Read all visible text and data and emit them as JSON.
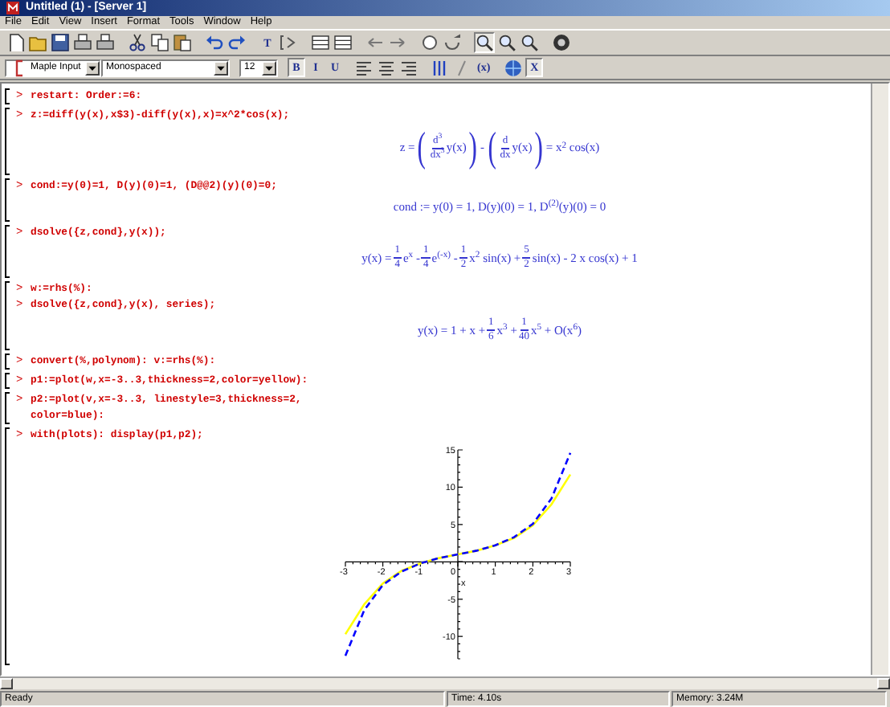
{
  "window": {
    "title": "Untitled (1) - [Server 1]"
  },
  "menu": [
    "File",
    "Edit",
    "View",
    "Insert",
    "Format",
    "Tools",
    "Window",
    "Help"
  ],
  "toolbar": [
    [
      {
        "kind": "new"
      },
      {
        "kind": "open"
      },
      {
        "kind": "save"
      },
      {
        "kind": "print"
      },
      {
        "kind": "print"
      }
    ],
    [
      {
        "kind": "cut"
      },
      {
        "kind": "copy"
      },
      {
        "kind": "paste"
      }
    ],
    [
      {
        "kind": "undo"
      },
      {
        "kind": "redo"
      }
    ],
    [
      {
        "kind": "letter",
        "label": "T"
      },
      {
        "kind": "prompt"
      }
    ],
    [
      {
        "kind": "grid"
      },
      {
        "kind": "grid"
      }
    ],
    [
      {
        "kind": "back"
      },
      {
        "kind": "forward"
      }
    ],
    [
      {
        "kind": "circle"
      },
      {
        "kind": "refresh"
      }
    ],
    [
      {
        "kind": "zoom",
        "selected": true
      },
      {
        "kind": "zoom",
        "selected": false
      },
      {
        "kind": "zoom",
        "selected": false
      }
    ],
    [
      {
        "kind": "help"
      }
    ]
  ],
  "format_bar": {
    "style": "Maple Input",
    "font": "Monospaced",
    "size": "12",
    "groups": [
      [
        {
          "kind": "letter",
          "label": "B",
          "selected": true
        },
        {
          "kind": "letter",
          "label": "I",
          "selected": false
        },
        {
          "kind": "letter",
          "label": "U",
          "selected": false
        }
      ],
      [
        {
          "kind": "align_left"
        },
        {
          "kind": "align_center"
        },
        {
          "kind": "align_right"
        }
      ],
      [
        {
          "kind": "bars"
        },
        {
          "kind": "slash"
        },
        {
          "kind": "letter",
          "label": "(x)"
        }
      ],
      [
        {
          "kind": "globe",
          "selected": false
        },
        {
          "kind": "letter",
          "label": "X",
          "selected": true
        }
      ]
    ]
  },
  "worksheet": [
    {
      "inputs": [
        {
          "prompt": ">",
          "lines": [
            "restart: Order:=6:"
          ]
        }
      ]
    },
    {
      "inputs": [
        {
          "prompt": ">",
          "lines": [
            "z:=diff(y(x),x$3)-diff(y(x),x)=x^2*cos(x);"
          ]
        }
      ],
      "output": {
        "kind": "math",
        "tokens": [
          {
            "kind": "text",
            "text": "z = "
          },
          {
            "kind": "paren",
            "text": "("
          },
          {
            "kind": "frac",
            "num": "d$^{3}$",
            "den": "dx$^{3}$"
          },
          {
            "kind": "text",
            "text": "y(x)"
          },
          {
            "kind": "paren",
            "text": ")"
          },
          {
            "kind": "text",
            "text": " - "
          },
          {
            "kind": "paren",
            "text": "("
          },
          {
            "kind": "frac",
            "num": "d",
            "den": "dx"
          },
          {
            "kind": "text",
            "text": "y(x)"
          },
          {
            "kind": "paren",
            "text": ")"
          },
          {
            "kind": "text",
            "text": " = x$^{2}$ cos(x)"
          }
        ]
      }
    },
    {
      "inputs": [
        {
          "prompt": ">",
          "lines": [
            "cond:=y(0)=1, D(y)(0)=1, (D@@2)(y)(0)=0;"
          ]
        }
      ],
      "output": {
        "kind": "math",
        "tokens": [
          {
            "kind": "text",
            "text": "cond := y(0) = 1, D(y)(0) = 1, D$^{(2)}$(y)(0) = 0"
          }
        ]
      }
    },
    {
      "inputs": [
        {
          "prompt": ">",
          "lines": [
            "dsolve({z,cond},y(x));"
          ]
        }
      ],
      "output": {
        "kind": "math",
        "tokens": [
          {
            "kind": "text",
            "text": "y(x) = "
          },
          {
            "kind": "frac",
            "num": "1",
            "den": "4"
          },
          {
            "kind": "text",
            "text": "e$^{x}$ - "
          },
          {
            "kind": "frac",
            "num": "1",
            "den": "4"
          },
          {
            "kind": "text",
            "text": "e$^{(-x)}$ - "
          },
          {
            "kind": "frac",
            "num": "1",
            "den": "2"
          },
          {
            "kind": "text",
            "text": "x$^{2}$ sin(x) + "
          },
          {
            "kind": "frac",
            "num": "5",
            "den": "2"
          },
          {
            "kind": "text",
            "text": "sin(x) - 2 x cos(x) + 1"
          }
        ]
      }
    },
    {
      "inputs": [
        {
          "prompt": ">",
          "lines": [
            "w:=rhs(%):"
          ]
        },
        {
          "prompt": ">",
          "lines": [
            "dsolve({z,cond},y(x), series);"
          ]
        }
      ],
      "output": {
        "kind": "math",
        "tokens": [
          {
            "kind": "text",
            "text": "y(x) = 1 + x + "
          },
          {
            "kind": "frac",
            "num": "1",
            "den": "6"
          },
          {
            "kind": "text",
            "text": "x$^{3}$ + "
          },
          {
            "kind": "frac",
            "num": "1",
            "den": "40"
          },
          {
            "kind": "text",
            "text": "x$^{5}$ + O(x$^{6}$)"
          }
        ]
      }
    },
    {
      "inputs": [
        {
          "prompt": ">",
          "lines": [
            "convert(%,polynom): v:=rhs(%):"
          ]
        }
      ]
    },
    {
      "inputs": [
        {
          "prompt": ">",
          "lines": [
            "p1:=plot(w,x=-3..3,thickness=2,color=yellow):"
          ]
        }
      ]
    },
    {
      "inputs": [
        {
          "prompt": ">",
          "lines": [
            "p2:=plot(v,x=-3..3, linestyle=3,thickness=2,",
            "color=blue):"
          ]
        }
      ]
    },
    {
      "inputs": [
        {
          "prompt": ">",
          "lines": [
            "with(plots): display(p1,p2);"
          ]
        }
      ],
      "output": {
        "kind": "plot",
        "chart_data": {
          "type": "line",
          "xlabel": "x",
          "x": [
            -3,
            -2.5,
            -2,
            -1.5,
            -1,
            -0.5,
            0,
            0.5,
            1,
            1.5,
            2,
            2.5,
            3
          ],
          "series": [
            {
              "color": "#ffff00",
              "line_style": "solid",
              "values": [
                -9.7,
                -5.7,
                -2.9,
                -1.2,
                -0.2,
                0.5,
                1,
                1.5,
                2.2,
                3.2,
                4.9,
                7.7,
                11.7
              ]
            },
            {
              "color": "#0000ff",
              "line_style": "dashed",
              "values": [
                -12.6,
                -6.5,
                -3.1,
                -1.3,
                -0.2,
                0.5,
                1,
                1.5,
                2.2,
                3.3,
                5.1,
                8.5,
                14.6
              ]
            }
          ],
          "xlim": [
            -3,
            3
          ],
          "ylim": [
            -13,
            15
          ],
          "xticks": [
            -3,
            -2,
            -1,
            0,
            1,
            2,
            3
          ],
          "yticks": [
            -10,
            -5,
            5,
            10,
            15
          ]
        }
      }
    }
  ],
  "status_bar": [
    "Ready",
    "Time: 4.10s",
    "Memory: 3.24M"
  ]
}
